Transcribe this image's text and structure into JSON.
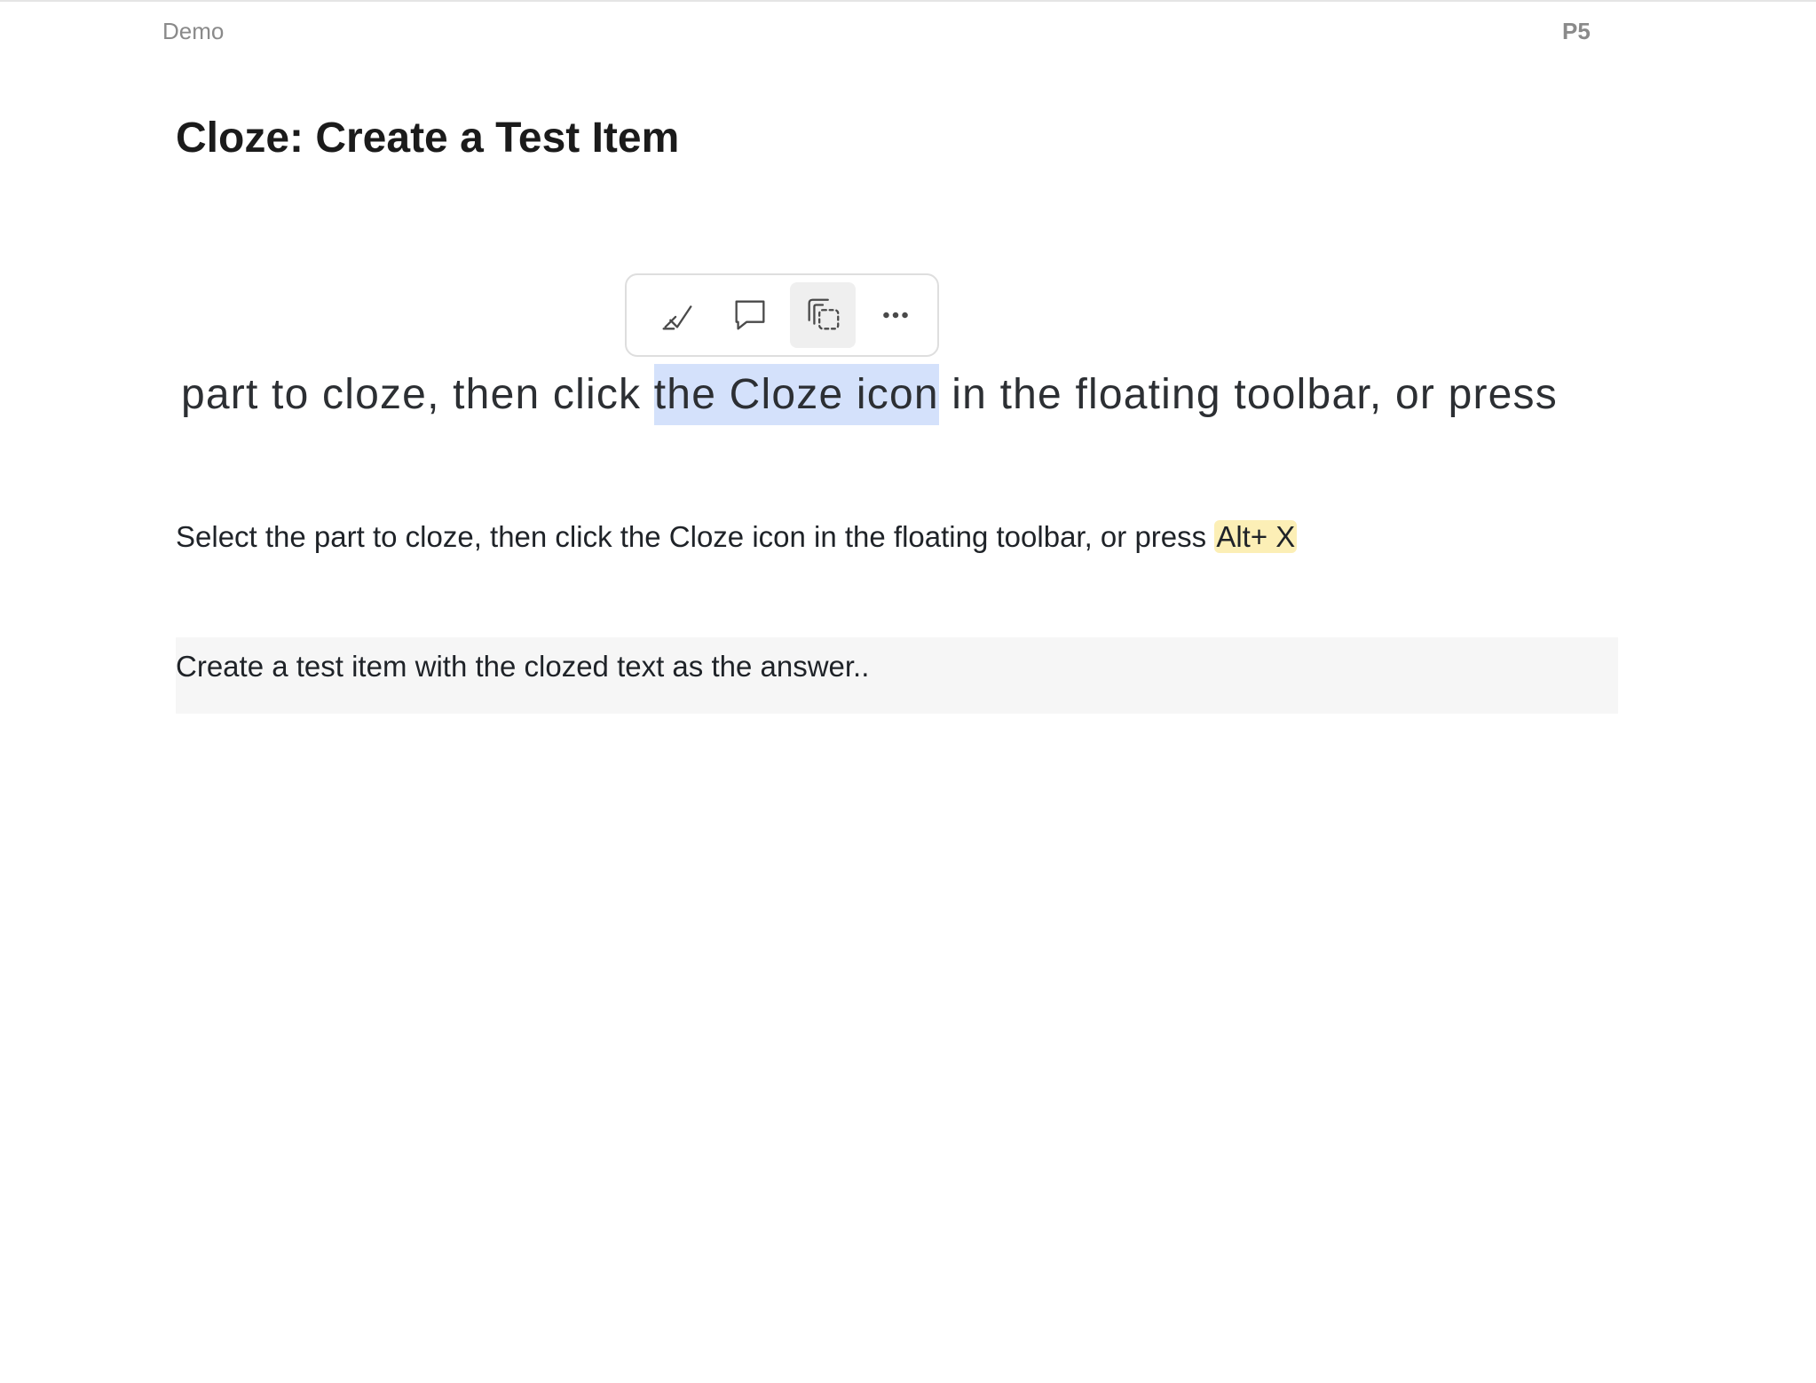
{
  "header": {
    "left_label": "Demo",
    "page_badge": "P5"
  },
  "main": {
    "title": "Cloze: Create a Test Item",
    "zoom_text": {
      "before": "part to cloze, then click ",
      "selected": "the Cloze icon",
      "after": " in the floating toolbar, or press"
    },
    "instruction": {
      "text": "Select the part to cloze, then click the Cloze icon in the floating toolbar, or press ",
      "shortcut": "Alt+ X"
    },
    "note": "Create a test item with the clozed text as the answer.."
  },
  "toolbar": {
    "buttons": [
      {
        "icon": "highlighter-icon",
        "active": false
      },
      {
        "icon": "comment-icon",
        "active": false
      },
      {
        "icon": "cloze-icon",
        "active": true
      },
      {
        "icon": "more-icon",
        "active": false
      }
    ]
  },
  "colors": {
    "selection": "#d4e1fb",
    "shortcut_highlight": "#fcefb6",
    "note_background": "#f6f6f6"
  }
}
